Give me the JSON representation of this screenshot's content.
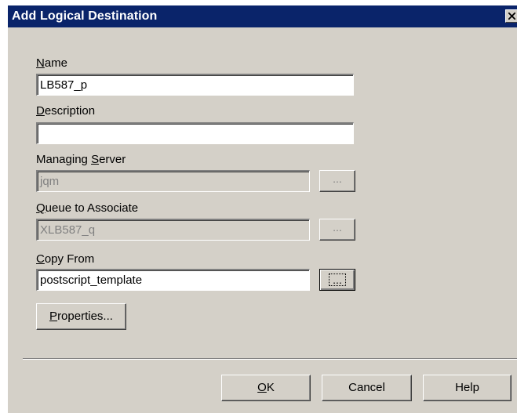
{
  "window": {
    "title": "Add Logical Destination",
    "close_icon": "close-icon"
  },
  "fields": {
    "name": {
      "label_u": "N",
      "label_rest": "ame",
      "value": "LB587_p"
    },
    "description": {
      "label_u": "D",
      "label_rest": "escription",
      "value": ""
    },
    "managing_server": {
      "label_pre": "Managing ",
      "label_u": "S",
      "label_rest": "erver",
      "value": "jqm",
      "browse": "..."
    },
    "queue": {
      "label_u": "Q",
      "label_rest": "ueue to Associate",
      "value": "XLB587_q",
      "browse": "..."
    },
    "copy_from": {
      "label_u": "C",
      "label_rest": "opy From",
      "value": "postscript_template",
      "browse": "..."
    }
  },
  "buttons": {
    "properties": {
      "u": "P",
      "rest": "roperties..."
    },
    "ok": {
      "u": "O",
      "rest": "K"
    },
    "cancel": "Cancel",
    "help": "Help"
  }
}
